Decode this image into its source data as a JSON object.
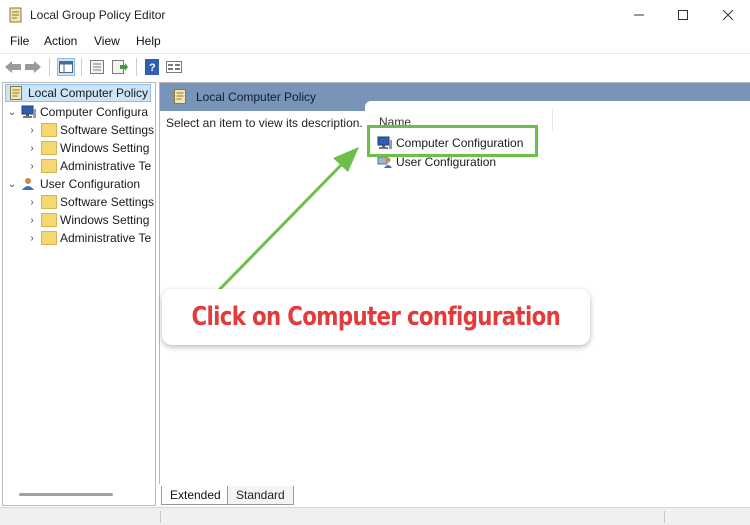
{
  "window": {
    "title": "Local Group Policy Editor",
    "controls": {
      "minimize": "—",
      "maximize": "☐",
      "close": "✕"
    }
  },
  "menubar": {
    "items": [
      "File",
      "Action",
      "View",
      "Help"
    ]
  },
  "toolbar": {
    "icons": [
      "back-icon",
      "forward-icon",
      "show-hide-tree-icon",
      "properties-icon",
      "export-list-icon",
      "help-icon",
      "view-icon"
    ]
  },
  "tree": {
    "root": "Local Computer Policy",
    "computer_configuration": {
      "label": "Computer Configura",
      "children": [
        "Software Settings",
        "Windows Setting",
        "Administrative Te"
      ]
    },
    "user_configuration": {
      "label": "User Configuration",
      "children": [
        "Software Settings",
        "Windows Setting",
        "Administrative Te"
      ]
    }
  },
  "details": {
    "header": "Local Computer Policy",
    "description": "Select an item to view its description.",
    "column_name": "Name",
    "items": [
      "Computer Configuration",
      "User Configuration"
    ]
  },
  "tabs": [
    "Extended",
    "Standard"
  ],
  "annotation": {
    "callout_text": "Click on Computer configuration",
    "arrow_color": "#6cc04a",
    "text_color": "#e33b3b"
  },
  "colors": {
    "header_blue": "#7895b8",
    "selection": "#cce4f7",
    "folder": "#f7d774"
  }
}
